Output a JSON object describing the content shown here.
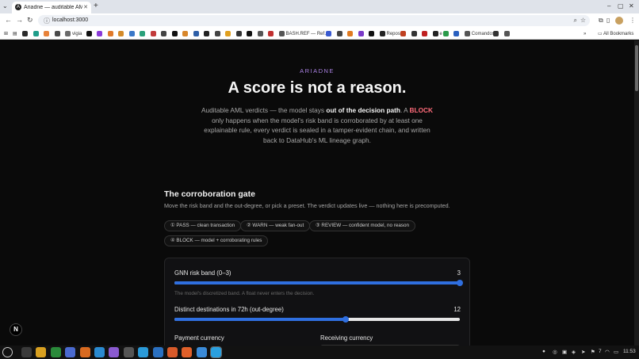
{
  "browser": {
    "tab_title": "Ariadne — auditable AML ver…",
    "tab_favicon": "A",
    "url": "localhost:3000",
    "bookmarks": [
      {
        "label": "",
        "color": "#2b2b2b"
      },
      {
        "label": "",
        "color": "#1f9d8a"
      },
      {
        "label": "",
        "color": "#e8833a"
      },
      {
        "label": "",
        "color": "#4a4a4a"
      },
      {
        "label": "vigia",
        "color": "#6a6a6a"
      },
      {
        "label": "",
        "color": "#111111"
      },
      {
        "label": "",
        "color": "#8a3ad8"
      },
      {
        "label": "",
        "color": "#e07a2a"
      },
      {
        "label": "",
        "color": "#d48b2a"
      },
      {
        "label": "",
        "color": "#3a78c8"
      },
      {
        "label": "",
        "color": "#2aa07a"
      },
      {
        "label": "",
        "color": "#c23b3b"
      },
      {
        "label": "",
        "color": "#444444"
      },
      {
        "label": "",
        "color": "#111111"
      },
      {
        "label": "",
        "color": "#d8862a"
      },
      {
        "label": "",
        "color": "#2e5fa8"
      },
      {
        "label": "",
        "color": "#222222"
      },
      {
        "label": "",
        "color": "#444444"
      },
      {
        "label": "",
        "color": "#e0a020"
      },
      {
        "label": "",
        "color": "#333333"
      },
      {
        "label": "",
        "color": "#111111"
      },
      {
        "label": "",
        "color": "#555555"
      },
      {
        "label": "",
        "color": "#c03030"
      },
      {
        "label": "BASH.REF — Ref…",
        "color": "#555555"
      },
      {
        "label": "",
        "color": "#3a5ad0"
      },
      {
        "label": "",
        "color": "#444444"
      },
      {
        "label": "",
        "color": "#e07a20"
      },
      {
        "label": "",
        "color": "#7a3ac8"
      },
      {
        "label": "",
        "color": "#111111"
      },
      {
        "label": "Repos",
        "color": "#222222"
      },
      {
        "label": "",
        "color": "#c04020"
      },
      {
        "label": "",
        "color": "#333333"
      },
      {
        "label": "",
        "color": "#c02020"
      },
      {
        "label": "e",
        "color": "#222222"
      },
      {
        "label": "",
        "color": "#2a9a4a"
      },
      {
        "label": "",
        "color": "#2a60c0"
      },
      {
        "label": "Comandos",
        "color": "#555555"
      },
      {
        "label": "",
        "color": "#333333"
      },
      {
        "label": "",
        "color": "#555555"
      }
    ],
    "all_bookmarks_label": "All Bookmarks"
  },
  "hero": {
    "eyebrow": "ARIADNE",
    "title": "A score is not a reason.",
    "sub_1": "Auditable AML verdicts — the model stays ",
    "sub_bold": "out of the decision path",
    "sub_2": ". A ",
    "sub_block": "BLOCK",
    "sub_3": " only happens when the model's risk band is corroborated by at least one explainable rule, every verdict is sealed in a tamper-evident chain, and written back to DataHub's ML lineage graph."
  },
  "gate": {
    "title": "The corroboration gate",
    "subtitle": "Move the risk band and the out-degree, or pick a preset. The verdict updates live — nothing here is precomputed.",
    "presets": [
      "① PASS — clean transaction",
      "② WARN — weak fan-out",
      "③ REVIEW — confident model, no reason",
      "④ BLOCK — model + corroborating rules"
    ],
    "risk_band": {
      "label": "GNN risk band (0–3)",
      "value": "3",
      "level": 1.0,
      "hint": "The model's discretized band. A float never enters the decision."
    },
    "out_degree": {
      "label": "Distinct destinations in 72h (out-degree)",
      "value": "12",
      "level": 0.6
    },
    "payment_currency_label": "Payment currency",
    "receiving_currency_label": "Receiving currency"
  },
  "nextjs_badge": "N",
  "taskbar": {
    "apps": [
      "#3a3a3a",
      "#d8a020",
      "#2a8a3a",
      "#4a6ad0",
      "#d86a20",
      "#2a8ad0",
      "#8a5ad0",
      "#555555",
      "#2a9ad8",
      "#2a70c0",
      "#d85a2a",
      "#e0602a",
      "#3a8ad8",
      "#2aa0e0"
    ],
    "tray_count": "7",
    "clock": "11:53"
  }
}
